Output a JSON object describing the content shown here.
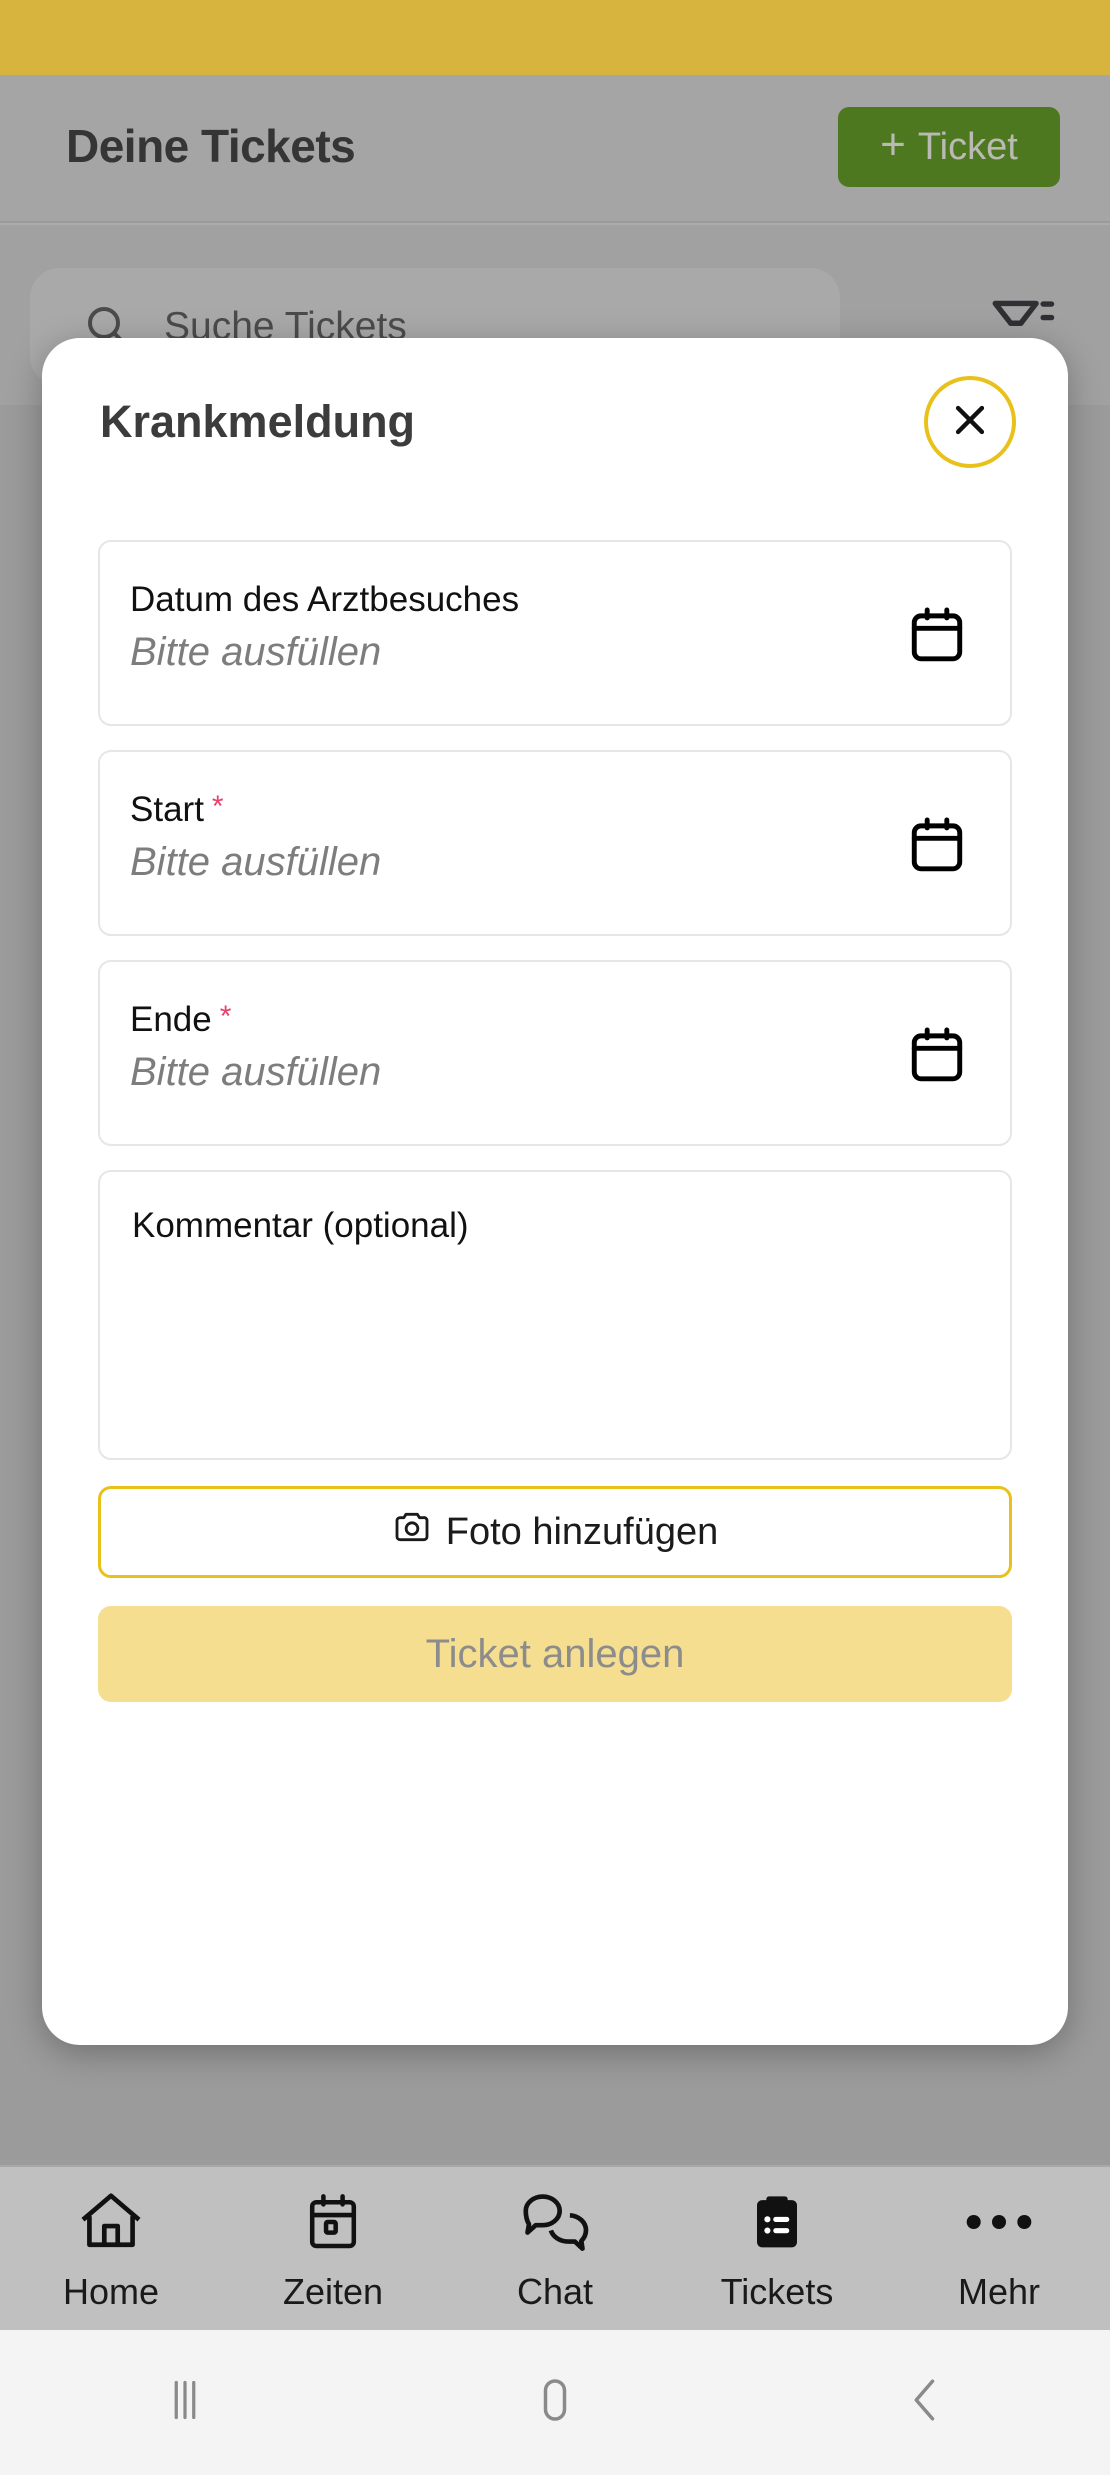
{
  "status_bar": {
    "color": "#fcd039"
  },
  "app": {
    "title": "Deine Tickets",
    "add_ticket_label": "Ticket",
    "add_ticket_plus": "+",
    "add_ticket_color": "#4d8312",
    "search_placeholder": "Suche Tickets",
    "search_icon": "search-icon",
    "filter_icon": "filter-icon"
  },
  "modal": {
    "title": "Krankmeldung",
    "close_icon": "close-icon",
    "accent_color": "#e8c11a",
    "required_color": "#e8416a",
    "fields": [
      {
        "label": "Datum des Arztbesuches",
        "required": "",
        "value": "Bitte ausfüllen",
        "icon": "calendar-icon"
      },
      {
        "label": "Start",
        "required": "*",
        "value": "Bitte ausfüllen",
        "icon": "calendar-icon"
      },
      {
        "label": "Ende",
        "required": "*",
        "value": "Bitte ausfüllen",
        "icon": "calendar-icon"
      }
    ],
    "comment": {
      "label": "Kommentar (optional)",
      "value": ""
    },
    "photo_button": {
      "label": "Foto hinzufügen",
      "icon": "camera-icon"
    },
    "submit_button": {
      "label": "Ticket anlegen",
      "color": "#f5de8f",
      "text_color": "#8c8c8c"
    }
  },
  "bottom_nav": {
    "items": [
      {
        "label": "Home",
        "icon": "home-icon",
        "active": false
      },
      {
        "label": "Zeiten",
        "icon": "calendar-icon",
        "active": false
      },
      {
        "label": "Chat",
        "icon": "chat-bubbles-icon",
        "active": false
      },
      {
        "label": "Tickets",
        "icon": "clipboard-list-icon",
        "active": true
      },
      {
        "label": "Mehr",
        "icon": "ellipsis-icon",
        "active": false
      }
    ]
  },
  "system_nav": {
    "recents_icon": "recents-icon",
    "home_icon": "home-pill-icon",
    "back_icon": "back-chevron-icon"
  }
}
